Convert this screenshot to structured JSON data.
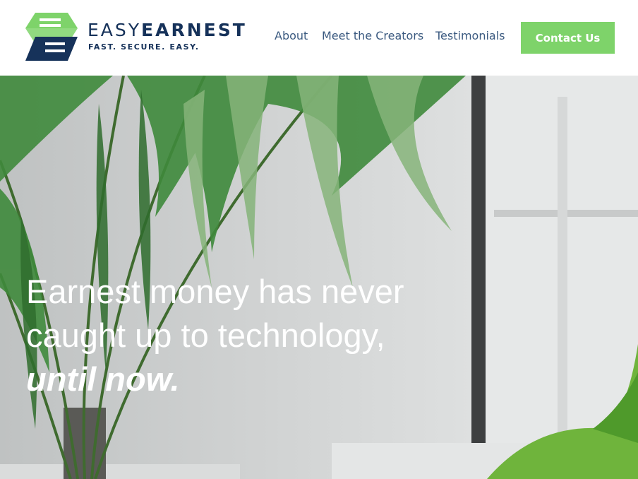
{
  "header": {
    "logo": {
      "brand_part1": "EASY",
      "brand_part2": "EARNEST",
      "tagline": "FAST. SECURE. EASY.",
      "colors": {
        "navy": "#16325a",
        "green": "#7ed36a"
      }
    },
    "nav": [
      {
        "label": "About"
      },
      {
        "label": "Meet the Creators"
      },
      {
        "label": "Testimonials"
      }
    ],
    "cta": {
      "label": "Contact Us",
      "color": "#7ed36a"
    }
  },
  "hero": {
    "headline_line1": "Earnest money has never",
    "headline_line2": "caught up to technology,",
    "headline_emphasis": "until now.",
    "background": "office-plant-photo"
  }
}
